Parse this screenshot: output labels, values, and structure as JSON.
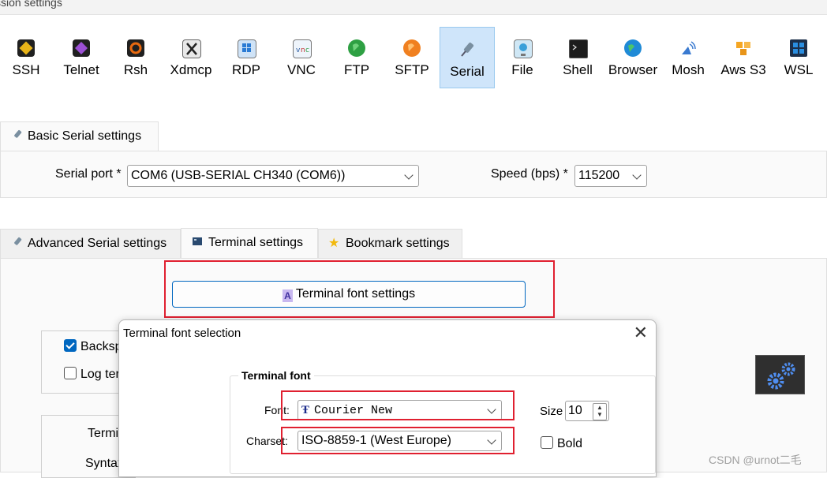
{
  "window": {
    "title": "ssion settings"
  },
  "session_types": [
    {
      "label": "SSH",
      "icon": "ssh-key-icon",
      "color": "#d4a017"
    },
    {
      "label": "Telnet",
      "icon": "telnet-icon",
      "color": "#8a3fbf"
    },
    {
      "label": "Rsh",
      "icon": "rsh-icon",
      "color": "#e06010"
    },
    {
      "label": "Xdmcp",
      "icon": "xdmcp-icon",
      "color": "#606060"
    },
    {
      "label": "RDP",
      "icon": "rdp-icon",
      "color": "#2a7bd4"
    },
    {
      "label": "VNC",
      "icon": "vnc-icon",
      "color": "#4a8ad0"
    },
    {
      "label": "FTP",
      "icon": "ftp-globe-icon",
      "color": "#2ea043"
    },
    {
      "label": "SFTP",
      "icon": "sftp-globe-icon",
      "color": "#f08020"
    },
    {
      "label": "Serial",
      "icon": "serial-plug-icon",
      "color": "#7a8fa0",
      "active": true
    },
    {
      "label": "File",
      "icon": "file-monitor-icon",
      "color": "#3a9ad9"
    },
    {
      "label": "Shell",
      "icon": "shell-terminal-icon",
      "color": "#202020"
    },
    {
      "label": "Browser",
      "icon": "browser-globe-icon",
      "color": "#1f8ad6"
    },
    {
      "label": "Mosh",
      "icon": "mosh-antenna-icon",
      "color": "#3a7ad0"
    },
    {
      "label": "Aws S3",
      "icon": "aws-s3-icon",
      "color": "#f5a623"
    },
    {
      "label": "WSL",
      "icon": "wsl-windows-icon",
      "color": "#0a66c2"
    }
  ],
  "basic_tab": {
    "label": "Basic Serial settings"
  },
  "basic": {
    "serial_port_label": "Serial port *",
    "serial_port_value": "COM6  (USB-SERIAL CH340 (COM6))",
    "speed_label": "Speed (bps) *",
    "speed_value": "115200"
  },
  "lower_tabs": {
    "advanced": "Advanced Serial settings",
    "terminal": "Terminal settings",
    "bookmark": "Bookmark settings"
  },
  "terminal": {
    "font_button": "Terminal font settings",
    "backspace_partial": "Backsp",
    "log_partial": "Log ter",
    "term_partial": "Termi",
    "syntax_partial": "Syntax"
  },
  "dialog": {
    "title": "Terminal font selection",
    "group_title": "Terminal font",
    "font_label": "Font:",
    "font_value": "Courier New",
    "size_label": "Size",
    "size_value": "10",
    "charset_label": "Charset:",
    "charset_value": "ISO-8859-1 (West Europe)",
    "bold_label": "Bold"
  },
  "watermark": "CSDN @urnot二毛"
}
